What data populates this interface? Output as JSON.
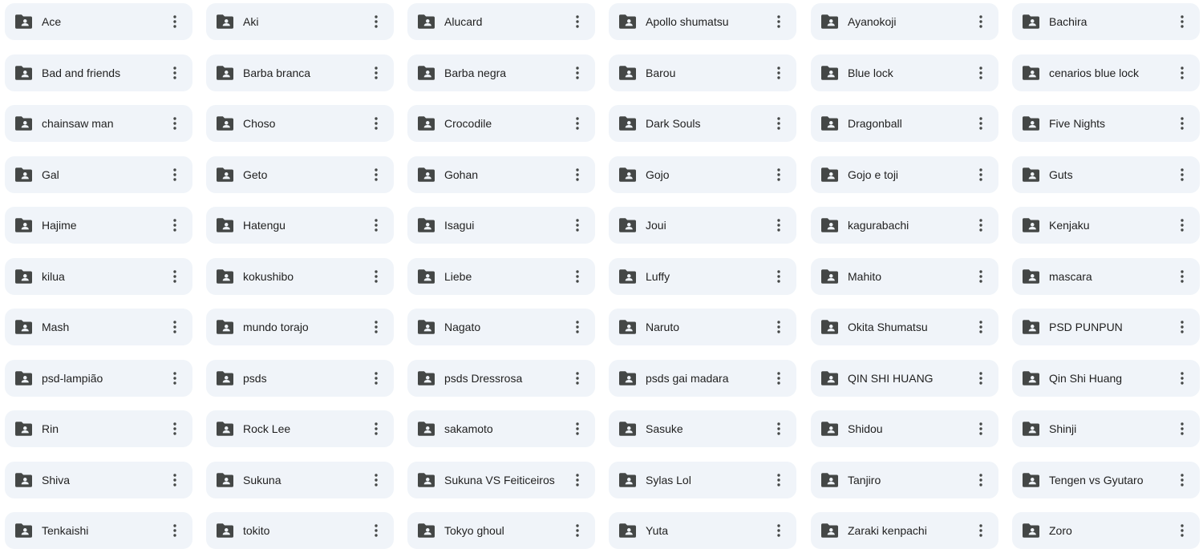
{
  "folders": [
    [
      "Ace",
      "Aki",
      "Alucard",
      "Apollo shumatsu",
      "Ayanokoji",
      "Bachira"
    ],
    [
      "Bad and friends",
      "Barba branca",
      "Barba negra",
      "Barou",
      "Blue lock",
      "cenarios blue lock"
    ],
    [
      "chainsaw man",
      "Choso",
      "Crocodile",
      "Dark Souls",
      "Dragonball",
      "Five Nights"
    ],
    [
      "Gal",
      "Geto",
      "Gohan",
      "Gojo",
      "Gojo e toji",
      "Guts"
    ],
    [
      "Hajime",
      "Hatengu",
      "Isagui",
      "Joui",
      "kagurabachi",
      "Kenjaku"
    ],
    [
      "kilua",
      "kokushibo",
      "Liebe",
      "Luffy",
      "Mahito",
      "mascara"
    ],
    [
      "Mash",
      "mundo torajo",
      "Nagato",
      "Naruto",
      "Okita Shumatsu",
      "PSD PUNPUN"
    ],
    [
      "psd-lampião",
      "psds",
      "psds Dressrosa",
      "psds gai madara",
      "QIN SHI HUANG",
      "Qin Shi Huang"
    ],
    [
      "Rin",
      "Rock Lee",
      "sakamoto",
      "Sasuke",
      "Shidou",
      "Shinji"
    ],
    [
      "Shiva",
      "Sukuna",
      "Sukuna VS Feiticeiros",
      "Sylas Lol",
      "Tanjiro",
      "Tengen vs Gyutaro"
    ],
    [
      "Tenkaishi",
      "tokito",
      "Tokyo ghoul",
      "Yuta",
      "Zaraki kenpachi",
      "Zoro"
    ]
  ],
  "icons": {
    "folder": "shared-folder-icon",
    "menu": "more-vert-icon"
  },
  "colors": {
    "card_background": "#f0f4f9",
    "icon": "#444746",
    "text": "#1f1f1f"
  }
}
